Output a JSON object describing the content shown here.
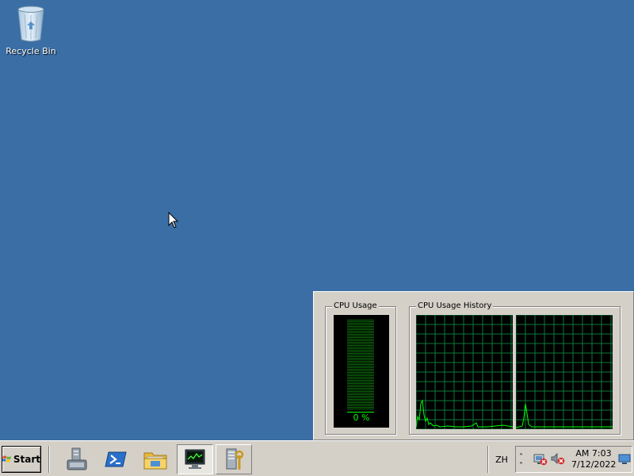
{
  "desktop": {
    "background_color": "#3a6ea5",
    "icons": [
      {
        "label": "Recycle Bin",
        "icon": "recycle-bin-icon"
      }
    ]
  },
  "task_manager_panel": {
    "cpu_usage": {
      "title": "CPU Usage",
      "percent_text": "0 %",
      "value_percent": 0
    },
    "cpu_history": {
      "title": "CPU Usage History",
      "graph_count": 2
    },
    "accent_color": "#00ff00"
  },
  "taskbar": {
    "start_label": "Start",
    "pinned": [
      {
        "icon": "server-manager-icon",
        "state": "normal"
      },
      {
        "icon": "powershell-icon",
        "state": "normal"
      },
      {
        "icon": "windows-explorer-icon",
        "state": "normal"
      },
      {
        "icon": "task-manager-icon",
        "state": "active"
      },
      {
        "icon": "server-tool-icon",
        "state": "raised"
      }
    ],
    "language": "ZH",
    "tray": {
      "icons": [
        "show-hidden-icons-chevron",
        "network-error-icon",
        "volume-muted-icon"
      ],
      "time": "AM 7:03",
      "date": "7/12/2022"
    }
  }
}
